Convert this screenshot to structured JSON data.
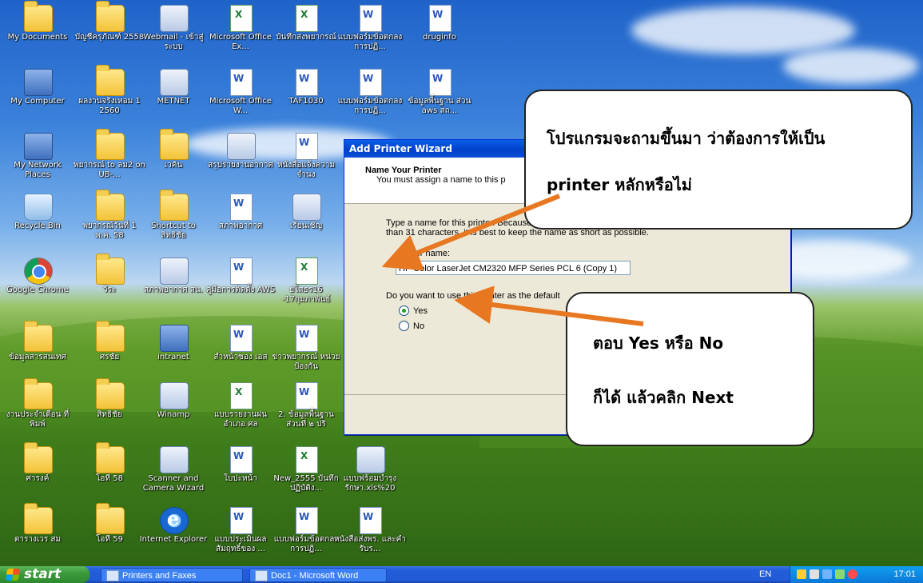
{
  "desktop_icons": [
    {
      "label": "My Documents",
      "icon": "documents-folder-icon"
    },
    {
      "label": "บัญชีครุภัณฑ์ 2558",
      "icon": "folder-icon"
    },
    {
      "label": "Webmail - เข้าสู่ระบบ",
      "icon": "shortcut-icon"
    },
    {
      "label": "Microsoft Office Ex...",
      "icon": "excel-icon"
    },
    {
      "label": "บันทึกส่งพยากรณ์",
      "icon": "excel-doc-icon"
    },
    {
      "label": "แบบฟอร์มข้อตกลงการปฏิ...",
      "icon": "word-doc-icon"
    },
    {
      "label": "druginfo",
      "icon": "word-doc-icon"
    },
    {
      "label": "My Computer",
      "icon": "computer-icon"
    },
    {
      "label": "ผลงานจริงเหอม 1 2560",
      "icon": "folder-icon"
    },
    {
      "label": "METNET",
      "icon": "shortcut-icon"
    },
    {
      "label": "Microsoft Office W...",
      "icon": "word-icon"
    },
    {
      "label": "TAF1030",
      "icon": "word-doc-icon"
    },
    {
      "label": "แบบฟอร์มข้อตกลงการปฏิ...",
      "icon": "word-doc-icon"
    },
    {
      "label": "ข้อมูลพื้นฐาน ส่วน aws สถ...",
      "icon": "word-doc-icon"
    },
    {
      "label": "My Network Places",
      "icon": "network-icon"
    },
    {
      "label": "พยากรณ์ to ลม2 on UB-...",
      "icon": "network-folder-icon"
    },
    {
      "label": "เวคิน",
      "icon": "folder-shortcut-icon"
    },
    {
      "label": "สรุปรายงานอากาศ",
      "icon": "text-doc-icon"
    },
    {
      "label": "หนังสือแจ้งความจำนง",
      "icon": "word-doc-icon"
    },
    {
      "label": "Recycle Bin",
      "icon": "recycle-bin-icon"
    },
    {
      "label": "พยากรณ์วันที่ 1 พ.ค. 58",
      "icon": "folder-icon"
    },
    {
      "label": "Shortcut to สิทธิชัย",
      "icon": "folder-shortcut-icon"
    },
    {
      "label": "สภาพอากาศ",
      "icon": "word-doc-icon"
    },
    {
      "label": "เรียนเชิญ",
      "icon": "image-doc-icon"
    },
    {
      "label": "Google Chrome",
      "icon": "chrome-icon"
    },
    {
      "label": "วีระ",
      "icon": "folder-icon"
    },
    {
      "label": "สภาพอากาศ สน.",
      "icon": "text-doc-icon"
    },
    {
      "label": "คู่มือการติดตั้ง AWS",
      "icon": "word-doc-icon"
    },
    {
      "label": "ยโสธร16 -17กุมภาพันธ์",
      "icon": "excel-doc-icon"
    },
    {
      "label": "ข้อมูลสารสนเทศ",
      "icon": "folder-icon"
    },
    {
      "label": "ศรชัย",
      "icon": "folder-icon"
    },
    {
      "label": "intranet",
      "icon": "network-shortcut-icon"
    },
    {
      "label": "สำหน้าซอง เอส",
      "icon": "word-doc-icon"
    },
    {
      "label": "ข่าวพยากรณ์ หน่วยป้องกัน",
      "icon": "word-doc-icon"
    },
    {
      "label": "งานประจำเดือน ที่พิมพ์",
      "icon": "folder-icon"
    },
    {
      "label": "สิทธิชัย",
      "icon": "folder-icon"
    },
    {
      "label": "Winamp",
      "icon": "winamp-icon"
    },
    {
      "label": "แบบรายงานฝน อำเภอ ศล",
      "icon": "excel-doc-icon"
    },
    {
      "label": "2. ข้อมูลพื้นฐาน ส่วนที่ ๒ ปริ",
      "icon": "word-doc-icon"
    },
    {
      "label": "ศารงค์",
      "icon": "folder-icon"
    },
    {
      "label": "โอที 58",
      "icon": "folder-icon"
    },
    {
      "label": "Scanner and Camera Wizard",
      "icon": "scanner-icon"
    },
    {
      "label": "ใบปะหน้า",
      "icon": "word-doc-icon"
    },
    {
      "label": "New_2555 บันทึกปฏิบัติง...",
      "icon": "excel-doc-icon"
    },
    {
      "label": "แบบฟร้อมบำรุงรักษา.xls%20",
      "icon": "image-doc-icon"
    },
    {
      "label": "ตารางเวร สม",
      "icon": "folder-icon"
    },
    {
      "label": "โอที 59",
      "icon": "folder-icon"
    },
    {
      "label": "Internet Explorer",
      "icon": "internet-explorer-icon"
    },
    {
      "label": "แบบประเมินผล สัมฤทธิ์ของ ...",
      "icon": "word-doc-icon"
    },
    {
      "label": "แบบฟอร์มข้อตกลงการปฏิ...",
      "icon": "word-doc-icon"
    },
    {
      "label": "หนังสือส่งพร. และคำรับร...",
      "icon": "word-doc-icon"
    }
  ],
  "wizard": {
    "title": "Add Printer Wizard",
    "heading": "Name Your Printer",
    "subheading": "You must assign a name to this p",
    "description": "Type a name for this printer. Because some program and server name combinations of more than 31 characters, it is best to keep the name as short as possible.",
    "printer_name_label": "Printer name:",
    "printer_name_value": "HP Color LaserJet CM2320 MFP Series PCL 6 (Copy 1)",
    "default_question": "Do you want to use this printer as the default",
    "options": [
      "Yes",
      "No"
    ],
    "selected_option": "Yes"
  },
  "callouts": {
    "first_line1": "โปรแกรมจะถามขึ้นมา ว่าต้องการให้เป็น",
    "first_line2": "printer หลักหรือไม่",
    "second_line1": "ตอบ Yes หรือ No",
    "second_line2": "ก็ได้ แล้วคลิก Next",
    "arrow_color": "#e87722"
  },
  "taskbar": {
    "start_label": "start",
    "tasks": [
      "Printers and Faxes",
      "Doc1 - Microsoft Word"
    ],
    "language": "EN",
    "clock": "17:01"
  }
}
